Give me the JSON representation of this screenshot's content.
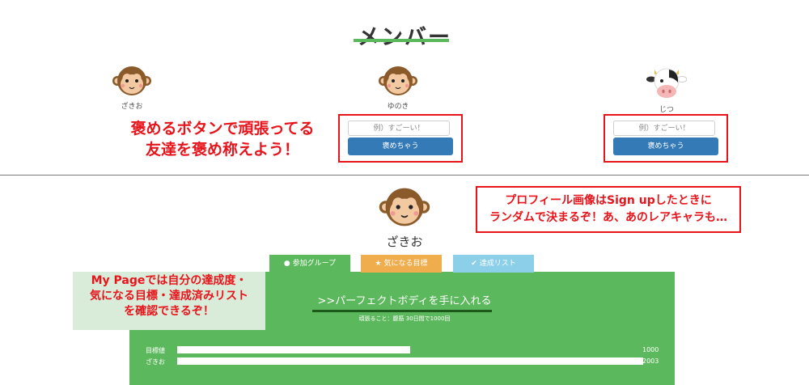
{
  "members_section": {
    "title": "メンバー",
    "members": [
      {
        "name": "ざきお",
        "avatar": "monkey-icon"
      },
      {
        "name": "ゆのき",
        "avatar": "monkey-icon",
        "placeholder": "例）すごーい！",
        "button": "褒めちゃう"
      },
      {
        "name": "じつ",
        "avatar": "cow-icon",
        "placeholder": "例）すごーい！",
        "button": "褒めちゃう"
      }
    ],
    "annotation_line1": "褒めるボタンで頑張ってる",
    "annotation_line2": "友達を褒め称えよう！"
  },
  "profile": {
    "avatar": "monkey-icon",
    "name": "ざきお",
    "annotation_line1": "プロフィール画像はSign upしたときに",
    "annotation_line2": "ランダムで決まるぞ！あ、あのレアキャラも…",
    "tabs": [
      {
        "label": "参加グループ",
        "icon": "user-icon",
        "color": "#5cb85c"
      },
      {
        "label": "気になる目標",
        "icon": "star-icon",
        "color": "#f0ad4e"
      },
      {
        "label": "達成リスト",
        "icon": "check-icon",
        "color": "#8ccfe8"
      }
    ],
    "goal": {
      "title": ">>パーフェクトボディを手に入れる",
      "subtitle": "頑張ること：腹筋 30日間で1000回"
    },
    "progress": [
      {
        "label": "目標値",
        "value": "1000",
        "fraction": 0.5
      },
      {
        "label": "ざきお",
        "value": "2003",
        "fraction": 1.0
      }
    ],
    "mypage_annotation": [
      "My Pageでは自分の達成度・",
      "気になる目標・達成済みリスト",
      "を確認できるぞ！"
    ]
  },
  "colors": {
    "accent_green": "#5cb85c",
    "button_blue": "#337ab7",
    "annotation_red": "#e8141c"
  }
}
